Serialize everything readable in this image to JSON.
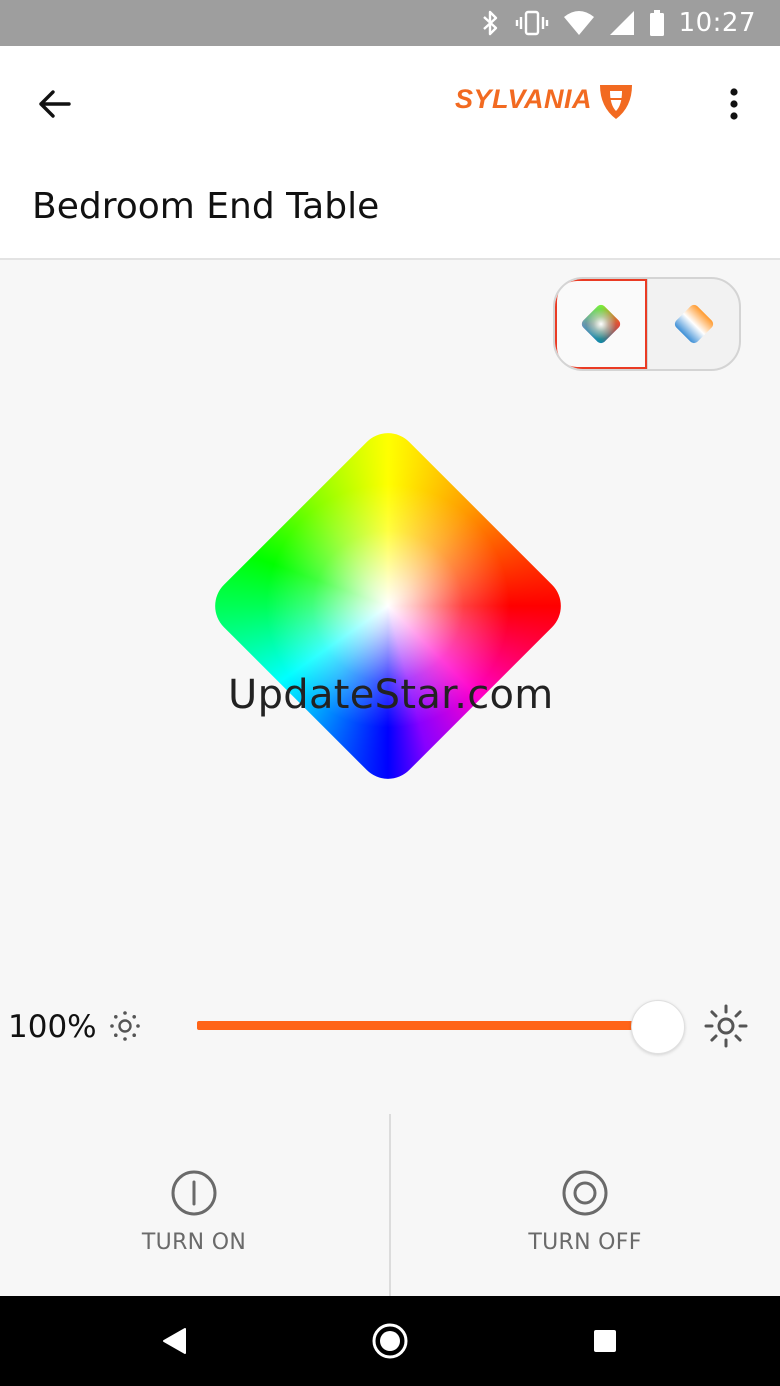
{
  "status_bar": {
    "time": "10:27",
    "icons": [
      "bluetooth-icon",
      "vibrate-icon",
      "wifi-icon",
      "signal-icon",
      "battery-icon"
    ]
  },
  "app_bar": {
    "brand": "SYLVANIA",
    "brand_color": "#f26a21",
    "title": "Bedroom End Table"
  },
  "mode_toggle": {
    "options": [
      {
        "icon": "color-mode-icon",
        "active": true
      },
      {
        "icon": "white-tone-mode-icon",
        "active": false
      }
    ],
    "active_border_color": "#ea3b24"
  },
  "watermark": "UpdateStar.com",
  "brightness": {
    "value_label": "100%",
    "level": 1.0,
    "track_color": "#ff6418"
  },
  "power": {
    "turn_on_label": "TURN ON",
    "turn_off_label": "TURN OFF"
  },
  "nav_bar": {
    "buttons": [
      "back-triangle-icon",
      "home-circle-icon",
      "recents-square-icon"
    ]
  }
}
